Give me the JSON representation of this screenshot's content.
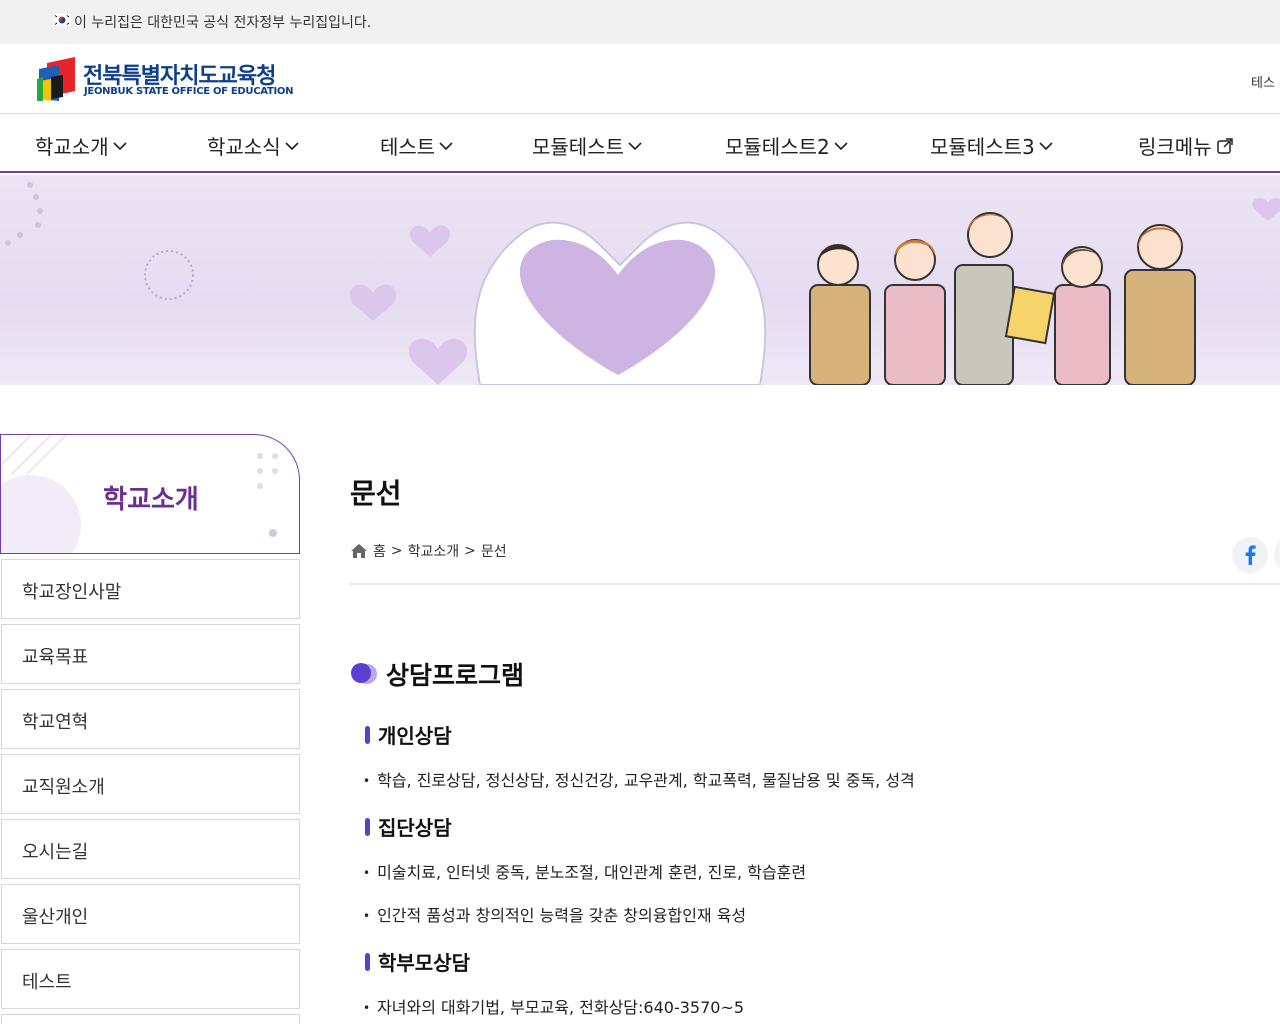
{
  "gov_banner": {
    "text": "이 누리집은 대한민국 공식 전자정부 누리집입니다."
  },
  "header": {
    "logo_title_ko": "전북특별자치도교육청",
    "logo_title_en": "JEONBUK STATE OFFICE OF EDUCATION",
    "util_link": "테스"
  },
  "gnb": {
    "items": [
      {
        "label": "학교소개",
        "icon": "chevron-down-icon"
      },
      {
        "label": "학교소식",
        "icon": "chevron-down-icon"
      },
      {
        "label": "테스트",
        "icon": "chevron-down-icon"
      },
      {
        "label": "모듈테스트",
        "icon": "chevron-down-icon"
      },
      {
        "label": "모듈테스트2",
        "icon": "chevron-down-icon"
      },
      {
        "label": "모듈테스트3",
        "icon": "chevron-down-icon"
      },
      {
        "label": "링크메뉴",
        "icon": "external-link-icon"
      }
    ]
  },
  "lnb": {
    "title": "학교소개",
    "items": [
      {
        "label": "학교장인사말"
      },
      {
        "label": "교육목표"
      },
      {
        "label": "학교연혁"
      },
      {
        "label": "교직원소개"
      },
      {
        "label": "오시는길"
      },
      {
        "label": "울산개인"
      },
      {
        "label": "테스트"
      }
    ]
  },
  "content": {
    "page_title": "문선",
    "breadcrumb": {
      "home": "홈",
      "sep1": ">",
      "level1": "학교소개",
      "sep2": ">",
      "current": "문선"
    },
    "section_title": "상담프로그램",
    "groups": [
      {
        "title": "개인상담",
        "items": [
          "학습, 진로상담, 정신상담, 정신건강, 교우관계, 학교폭력, 물질남용 및 중독, 성격"
        ]
      },
      {
        "title": "집단상담",
        "items": [
          "미술치료, 인터넷 중독, 분노조절, 대인관계 훈련, 진로, 학습훈련",
          "인간적 품성과 창의적인 능력을 갖춘 창의융합인재 육성"
        ]
      },
      {
        "title": "학부모상담",
        "items": [
          "자녀와의 대화기법, 부모교육, 전화상담:640-3570~5"
        ]
      }
    ]
  },
  "colors": {
    "accent_purple": "#6b3fb3",
    "lnb_title_color": "#6b2f8f",
    "sub_bar_color": "#5b3fd0",
    "logo_blue": "#0e3f8c"
  },
  "icons": {
    "flag": "korea-flag-icon",
    "home": "home-icon",
    "share": "facebook-icon"
  }
}
